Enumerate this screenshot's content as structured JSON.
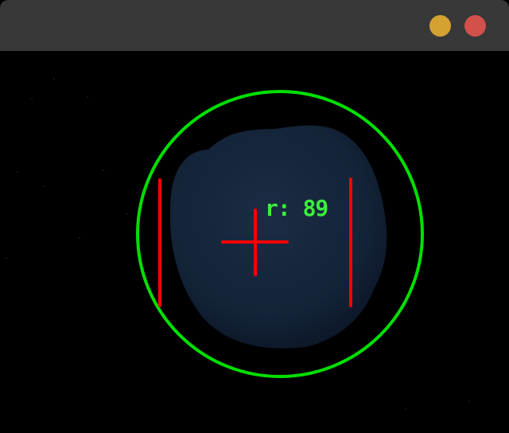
{
  "window": {
    "titlebar_color": "#383838",
    "background_color": "#000000",
    "buttons": [
      {
        "name": "minimize",
        "icon": "circle-button-icon",
        "color": "#d6a133"
      },
      {
        "name": "close",
        "icon": "circle-button-icon",
        "color": "#d2514b"
      }
    ]
  },
  "camera_view": {
    "object_color": "#132338",
    "detection_circle_color": "#00e000",
    "marker_color": "#ff0000",
    "radius_label_color": "#3cf03c",
    "radius_label": "r: 89",
    "radius_value": 89
  }
}
